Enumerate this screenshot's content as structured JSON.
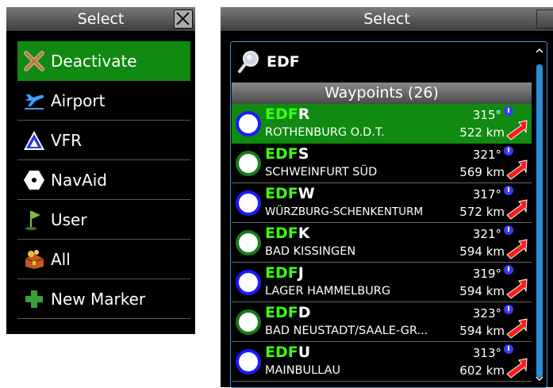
{
  "left_dialog": {
    "title": "Select",
    "items": [
      {
        "label": "Deactivate",
        "icon": "deactivate-x-icon",
        "selected": true
      },
      {
        "label": "Airport",
        "icon": "airport-plane-icon",
        "selected": false
      },
      {
        "label": "VFR",
        "icon": "vfr-triangle-icon",
        "selected": false
      },
      {
        "label": "NavAid",
        "icon": "navaid-hexagon-icon",
        "selected": false
      },
      {
        "label": "User",
        "icon": "user-flag-icon",
        "selected": false
      },
      {
        "label": "All",
        "icon": "all-treasure-icon",
        "selected": false
      },
      {
        "label": "New Marker",
        "icon": "plus-icon",
        "selected": false
      }
    ]
  },
  "right_dialog": {
    "title": "Select",
    "search": {
      "value": "EDF"
    },
    "section_header": "Waypoints (26)",
    "rows": [
      {
        "code_prefix": "EDF",
        "code_suffix": "R",
        "name": "ROTHENBURG O.D.T.",
        "bearing": "315°",
        "distance": "522 km",
        "circle": "blue",
        "selected": true
      },
      {
        "code_prefix": "EDF",
        "code_suffix": "S",
        "name": "SCHWEINFURT SÜD",
        "bearing": "321°",
        "distance": "569 km",
        "circle": "green",
        "selected": false
      },
      {
        "code_prefix": "EDF",
        "code_suffix": "W",
        "name": "WÜRZBURG-SCHENKENTURM",
        "bearing": "317°",
        "distance": "572 km",
        "circle": "blue",
        "selected": false
      },
      {
        "code_prefix": "EDF",
        "code_suffix": "K",
        "name": "BAD KISSINGEN",
        "bearing": "321°",
        "distance": "594 km",
        "circle": "green",
        "selected": false
      },
      {
        "code_prefix": "EDF",
        "code_suffix": "J",
        "name": "LAGER HAMMELBURG",
        "bearing": "319°",
        "distance": "594 km",
        "circle": "blue",
        "selected": false
      },
      {
        "code_prefix": "EDF",
        "code_suffix": "D",
        "name": "BAD NEUSTADT/SAALE-GR...",
        "bearing": "323°",
        "distance": "594 km",
        "circle": "green",
        "selected": false
      },
      {
        "code_prefix": "EDF",
        "code_suffix": "U",
        "name": "MAINBULLAU",
        "bearing": "313°",
        "distance": "602 km",
        "circle": "blue",
        "selected": false
      }
    ]
  },
  "colors": {
    "selected_bg": "#108a10",
    "code_prefix": "#39ff14",
    "scroll_thumb": "#2b8fd6",
    "circle_blue": "#1a1aff",
    "circle_green": "#1a7a1a"
  }
}
